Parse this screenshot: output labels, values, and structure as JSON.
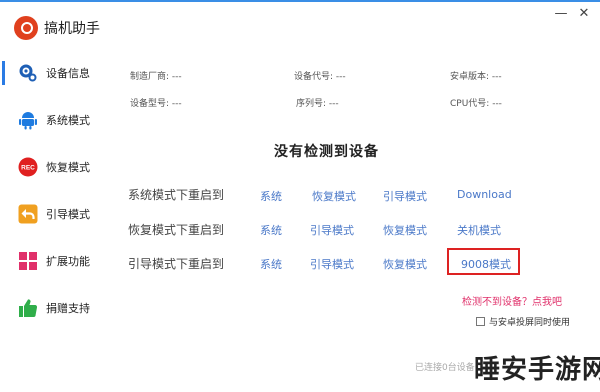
{
  "app": {
    "title": "搞机助手"
  },
  "window": {
    "minimize": "—",
    "close": "✕"
  },
  "sidebar": {
    "items": [
      {
        "label": "设备信息",
        "icon": "gear-icon",
        "color": "#1e5fb5",
        "active": true
      },
      {
        "label": "系统模式",
        "icon": "android-icon",
        "color": "#1e7be0"
      },
      {
        "label": "恢复模式",
        "icon": "rec-icon",
        "color": "#e02020",
        "badge": "REC"
      },
      {
        "label": "引导模式",
        "icon": "back-arrow-icon",
        "color": "#f0a020"
      },
      {
        "label": "扩展功能",
        "icon": "grid-icon",
        "color": "#e0306a"
      },
      {
        "label": "捐赠支持",
        "icon": "thumbs-up-icon",
        "color": "#2fae4a"
      }
    ]
  },
  "device_info": {
    "manufacturer": "制造厂商: ---",
    "device_code": "设备代号: ---",
    "android_version": "安卓版本: ---",
    "model": "设备型号: ---",
    "serial": "序列号: ---",
    "cpu": "CPU代号: ---"
  },
  "main": {
    "no_device": "没有检测到设备",
    "rows": [
      {
        "label": "系统模式下重启到",
        "options": [
          "系统",
          "恢复模式",
          "引导模式",
          "Download"
        ]
      },
      {
        "label": "恢复模式下重启到",
        "options": [
          "系统",
          "引导模式",
          "恢复模式",
          "关机模式"
        ]
      },
      {
        "label": "引导模式下重启到",
        "options": [
          "系统",
          "引导模式",
          "恢复模式",
          "9008模式"
        ]
      }
    ],
    "help_link": "检测不到设备？点我吧",
    "sync_checkbox_label": "与安卓投屏同时使用",
    "sync_checked": false
  },
  "status": {
    "text": "已连接0台设备"
  },
  "watermark": {
    "text": "睡安手游网"
  },
  "colors": {
    "accent": "#2a7be4",
    "link": "#4a78c8",
    "highlight_border": "#d22222",
    "help_link": "#e0306a"
  }
}
